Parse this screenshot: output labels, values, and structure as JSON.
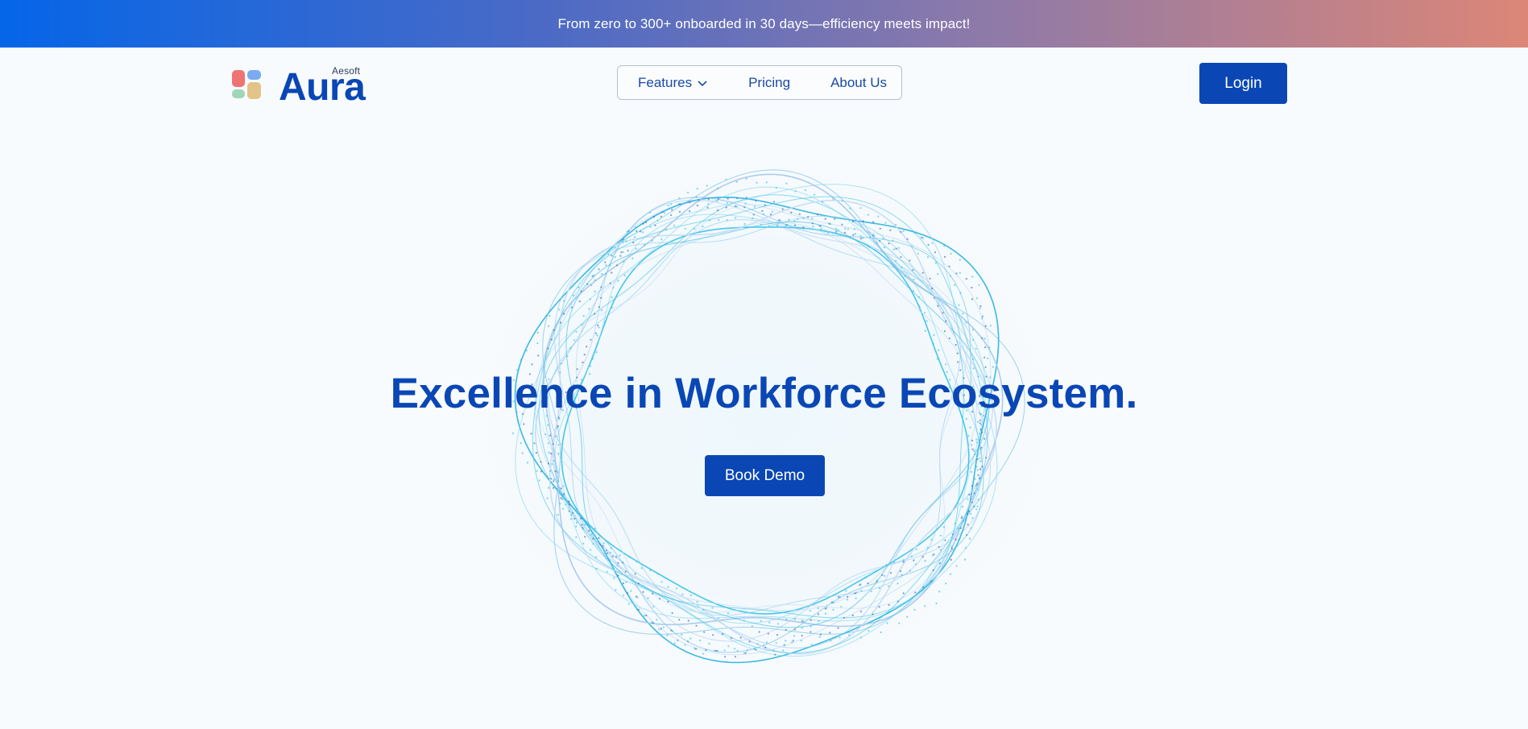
{
  "announcement": {
    "text": "From zero to 300+ onboarded in 30 days—efficiency meets impact!"
  },
  "brand": {
    "name": "Aura",
    "sub": "Aesoft",
    "tile_colors": [
      "#ee7474",
      "#7aaaf0",
      "#9fd5b8",
      "#e2c488"
    ]
  },
  "nav": {
    "items": [
      {
        "label": "Features",
        "icon": "chevron-down-icon"
      },
      {
        "label": "Pricing"
      },
      {
        "label": "About Us"
      }
    ]
  },
  "header": {
    "login_label": "Login"
  },
  "hero": {
    "title": "Excellence in Workforce Ecosystem.",
    "cta_label": "Book Demo",
    "art_icon": "wave-ring-graphic"
  },
  "colors": {
    "brand_blue": "#0a47b5",
    "banner_start": "#0566e8",
    "banner_end": "#dc8677",
    "ring_cyan": "#3cc4e8"
  }
}
